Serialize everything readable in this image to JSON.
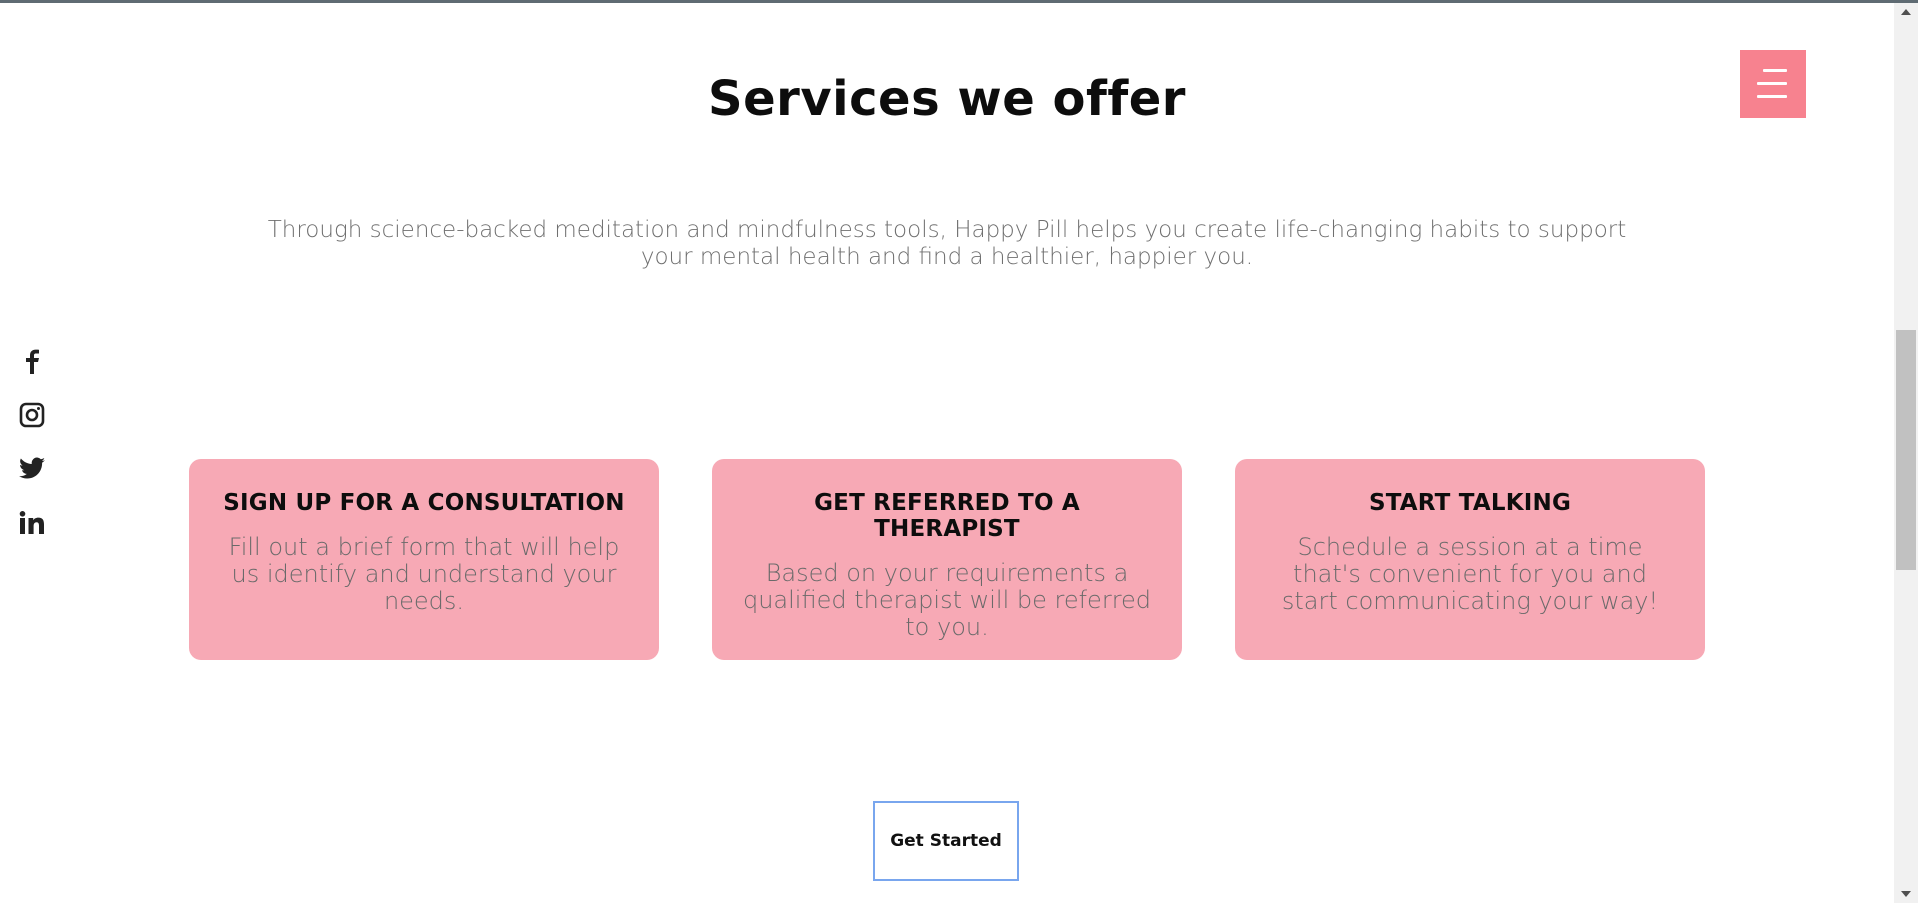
{
  "section": {
    "heading": "Services we offer",
    "intro_line1": "Through science-backed meditation and mindfulness tools, Happy Pill helps you create life-changing habits to support",
    "intro_line2": "your mental health and find a healthier, happier you."
  },
  "menu": {
    "icon": "hamburger-menu-icon",
    "color": "#f7828f"
  },
  "social": [
    {
      "name": "facebook-icon"
    },
    {
      "name": "instagram-icon"
    },
    {
      "name": "twitter-icon"
    },
    {
      "name": "linkedin-icon"
    }
  ],
  "cards": [
    {
      "title": "SIGN UP FOR A CONSULTATION",
      "text": "Fill out a brief form that will help us identify and understand your needs."
    },
    {
      "title": "GET REFERRED TO A THERAPIST",
      "text": "Based on your requirements a qualified therapist will be referred to you."
    },
    {
      "title": "START TALKING",
      "text": "Schedule a session at a time that's convenient for you and start communicating your way!"
    }
  ],
  "cta": {
    "label": "Get Started"
  },
  "colors": {
    "card_background": "#f7a9b5",
    "accent": "#f7828f",
    "cta_border": "#79a6ee"
  }
}
